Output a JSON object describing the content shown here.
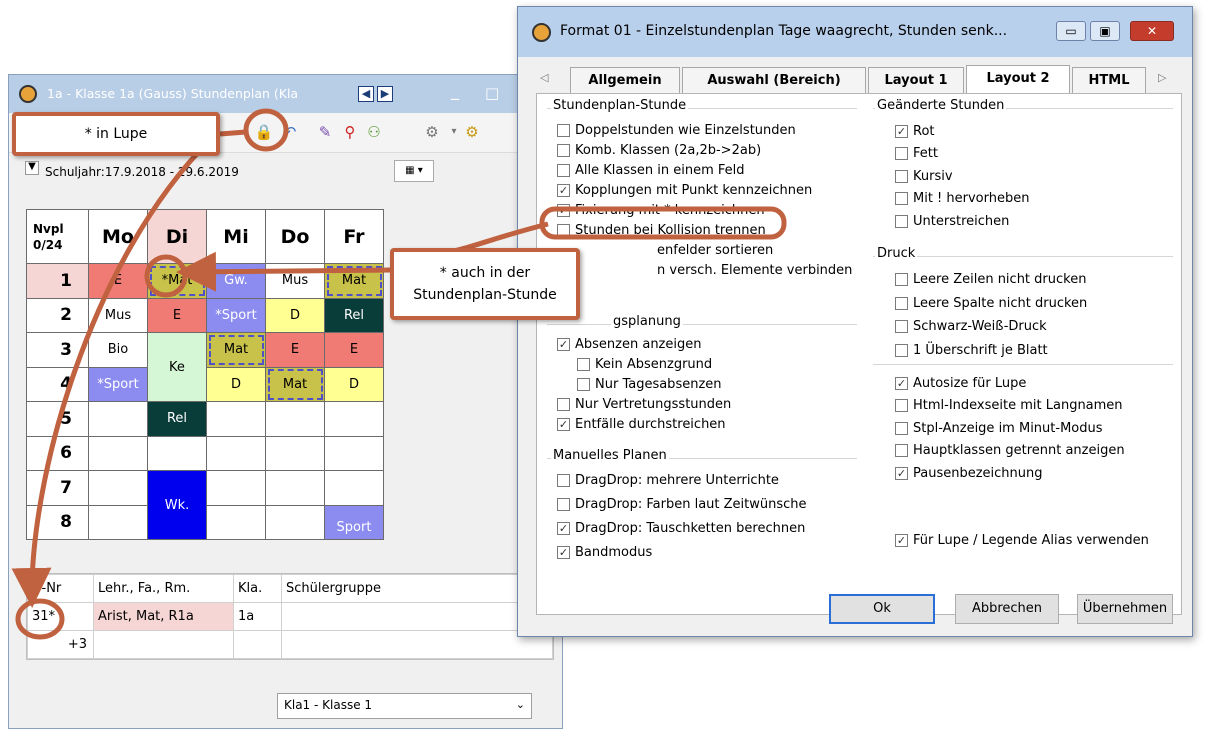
{
  "schedule_window": {
    "title": "1a - Klasse 1a (Gauss)  Stundenplan  (Kla",
    "nav_prev": "◀",
    "nav_next": "▶",
    "minimize": "_",
    "maximize": "□",
    "schuljahr": "Schuljahr:17.9.2018 - 29.6.2019",
    "nvpl_label": "Nvpl",
    "nvpl_value": "0/24",
    "days": [
      "Mo",
      "Di",
      "Mi",
      "Do",
      "Fr"
    ],
    "periods": [
      "1",
      "2",
      "3",
      "4",
      "5",
      "6",
      "7",
      "8"
    ],
    "cells": {
      "r1": [
        "E",
        "*Mat",
        "Gw.",
        "Mus",
        "Mat"
      ],
      "r2": [
        "Mus",
        "E",
        "*Sport",
        "D",
        "Rel"
      ],
      "r3": [
        "Bio",
        "Ke",
        "Mat",
        "E",
        "E"
      ],
      "r4": [
        "*Sport",
        "D",
        "Mat",
        "D"
      ],
      "r5": [
        "Rel"
      ],
      "r78": [
        "Wk.",
        "Sport"
      ]
    },
    "lower_table": {
      "headers": [
        "U-Nr",
        "Lehr., Fa., Rm.",
        "Kla.",
        "Schülergruppe"
      ],
      "row1": [
        "31*",
        "Arist, Mat, R1a",
        "1a",
        ""
      ],
      "row2": [
        "+3",
        "",
        "",
        ""
      ]
    },
    "class_select": "Kla1 - Klasse 1"
  },
  "dialog": {
    "title": "Format 01 - Einzelstundenplan Tage waagrecht, Stunden senk...",
    "tabs": [
      "Allgemein",
      "Auswahl (Bereich)",
      "Layout 1",
      "Layout 2",
      "HTML"
    ],
    "active_tab": "Layout 2",
    "left_groups": {
      "stundenplan_stunde": {
        "title": "Stundenplan-Stunde",
        "items": [
          {
            "label": "Doppelstunden wie Einzelstunden",
            "checked": false
          },
          {
            "label": "Komb. Klassen (2a,2b->2ab)",
            "checked": false
          },
          {
            "label": "Alle Klassen in einem Feld",
            "checked": false
          },
          {
            "label": "Kopplungen mit Punkt kennzeichnen",
            "checked": true
          },
          {
            "label": "Fixierung mit * kennzeichnen",
            "checked": true
          },
          {
            "label": "Stunden bei Kollision trennen",
            "checked": false
          },
          {
            "label": "enfelder sortieren",
            "checked": false
          },
          {
            "label": "n versch. Elemente verbinden",
            "checked": false
          }
        ]
      },
      "vertretungsplanung": {
        "title": "gsplanung",
        "items": [
          {
            "label": "Absenzen anzeigen",
            "checked": true
          },
          {
            "label": "Kein Absenzgrund",
            "checked": false
          },
          {
            "label": "Nur Tagesabsenzen",
            "checked": false
          },
          {
            "label": "Nur Vertretungsstunden",
            "checked": false
          },
          {
            "label": "Entfälle durchstreichen",
            "checked": true
          }
        ]
      },
      "manuelles_planen": {
        "title": "Manuelles Planen",
        "items": [
          {
            "label": "DragDrop: mehrere Unterrichte",
            "checked": false
          },
          {
            "label": "DragDrop: Farben laut Zeitwünsche",
            "checked": false
          },
          {
            "label": "DragDrop: Tauschketten berechnen",
            "checked": true
          },
          {
            "label": "Bandmodus",
            "checked": true
          }
        ]
      }
    },
    "right_groups": {
      "geaenderte": {
        "title": "Geänderte Stunden",
        "items": [
          {
            "label": "Rot",
            "checked": true
          },
          {
            "label": "Fett",
            "checked": false
          },
          {
            "label": "Kursiv",
            "checked": false
          },
          {
            "label": "Mit ! hervorheben",
            "checked": false
          },
          {
            "label": "Unterstreichen",
            "checked": false
          }
        ]
      },
      "druck": {
        "title": "Druck",
        "items": [
          {
            "label": "Leere Zeilen nicht drucken",
            "checked": false
          },
          {
            "label": "Leere Spalte nicht drucken",
            "checked": false
          },
          {
            "label": "Schwarz-Weiß-Druck",
            "checked": false
          },
          {
            "label": "1 Überschrift je Blatt",
            "checked": false
          }
        ]
      },
      "misc": {
        "items": [
          {
            "label": "Autosize für Lupe",
            "checked": true
          },
          {
            "label": "Html-Indexseite mit Langnamen",
            "checked": false
          },
          {
            "label": "Stpl-Anzeige im Minut-Modus",
            "checked": false
          },
          {
            "label": "Hauptklassen getrennt anzeigen",
            "checked": false
          },
          {
            "label": "Pausenbezeichnung",
            "checked": true
          }
        ]
      },
      "alias": {
        "label": "Für Lupe / Legende Alias verwenden",
        "checked": true
      }
    },
    "buttons": {
      "ok": "Ok",
      "cancel": "Abbrechen",
      "apply": "Übernehmen"
    },
    "close": "✕",
    "minimize": "▭",
    "maximize": "▣"
  },
  "callouts": {
    "lupe": "* in Lupe",
    "stunde_line1": "* auch in der",
    "stunde_line2": "Stundenplan-Stunde"
  },
  "colors": {
    "accent_callout": "#c0613f",
    "changed_red": "#f07b74",
    "fixed_olive": "#c9c24a",
    "yellow": "#ffff92",
    "blue": "#8c8cf0",
    "dark_teal": "#093d3a"
  }
}
